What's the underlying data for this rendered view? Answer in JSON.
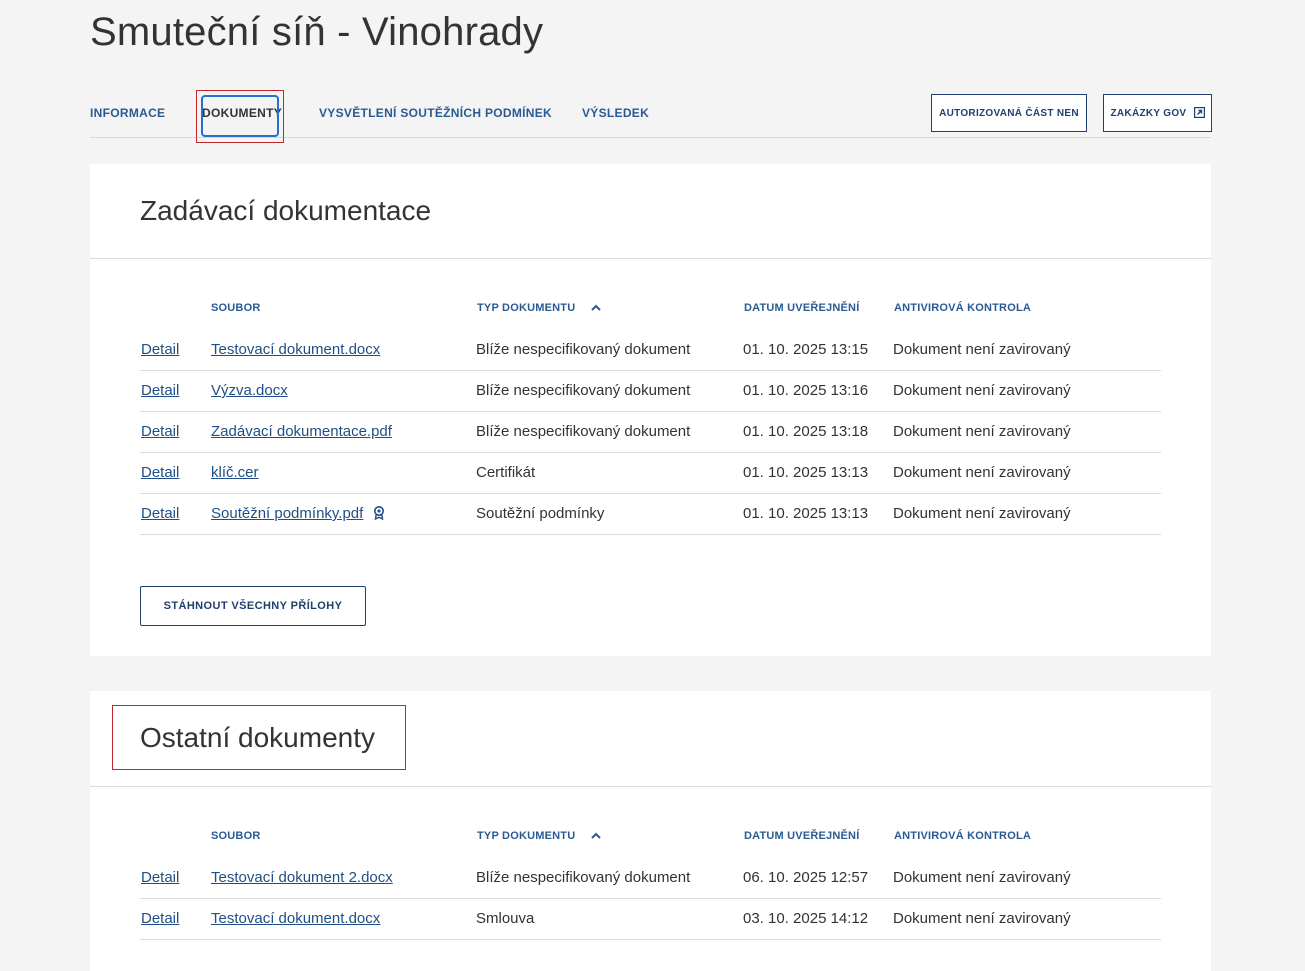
{
  "page": {
    "title": "Smuteční síň - Vinohrady"
  },
  "tabs": [
    {
      "label": "INFORMACE",
      "active": false
    },
    {
      "label": "DOKUMENTY",
      "active": true
    },
    {
      "label": "VYSVĚTLENÍ SOUTĚŽNÍCH PODMÍNEK",
      "active": false
    },
    {
      "label": "VÝSLEDEK",
      "active": false
    }
  ],
  "actions": {
    "authorized_label": "AUTORIZOVANÁ ČÁST NEN",
    "gov_label": "ZAKÁZKY GOV"
  },
  "columns": {
    "file": "SOUBOR",
    "type": "TYP DOKUMENTU",
    "date": "DATUM UVEŘEJNĚNÍ",
    "antivirus": "ANTIVIROVÁ KONTROLA"
  },
  "sections": [
    {
      "title": "Zadávací dokumentace",
      "rows": [
        {
          "detail": "Detail",
          "file": "Testovací dokument.docx",
          "type": "Blíže nespecifikovaný dokument",
          "date": "01. 10. 2025 13:15",
          "antivirus": "Dokument není zavirovaný"
        },
        {
          "detail": "Detail",
          "file": "Výzva.docx",
          "type": "Blíže nespecifikovaný dokument",
          "date": "01. 10. 2025 13:16",
          "antivirus": "Dokument není zavirovaný"
        },
        {
          "detail": "Detail",
          "file": "Zadávací dokumentace.pdf",
          "type": "Blíže nespecifikovaný dokument",
          "date": "01. 10. 2025 13:18",
          "antivirus": "Dokument není zavirovaný"
        },
        {
          "detail": "Detail",
          "file": "klíč.cer",
          "type": "Certifikát",
          "date": "01. 10. 2025 13:13",
          "antivirus": "Dokument není zavirovaný"
        },
        {
          "detail": "Detail",
          "file": "Soutěžní podmínky.pdf",
          "type": "Soutěžní podmínky",
          "date": "01. 10. 2025 13:13",
          "antivirus": "Dokument není zavirovaný",
          "signed_icon": "seal-icon"
        }
      ],
      "download_label": "STÁHNOUT VŠECHNY PŘÍLOHY"
    },
    {
      "title": "Ostatní dokumenty",
      "rows": [
        {
          "detail": "Detail",
          "file": "Testovací dokument 2.docx",
          "type": "Blíže nespecifikovaný dokument",
          "date": "06. 10. 2025 12:57",
          "antivirus": "Dokument není zavirovaný"
        },
        {
          "detail": "Detail",
          "file": "Testovací dokument.docx",
          "type": "Smlouva",
          "date": "03. 10. 2025 14:12",
          "antivirus": "Dokument není zavirovaný"
        }
      ]
    }
  ],
  "colors": {
    "link": "#1f4f86",
    "accent": "#2a5a93",
    "highlight": "#c0282d",
    "background": "#f4f4f4"
  }
}
